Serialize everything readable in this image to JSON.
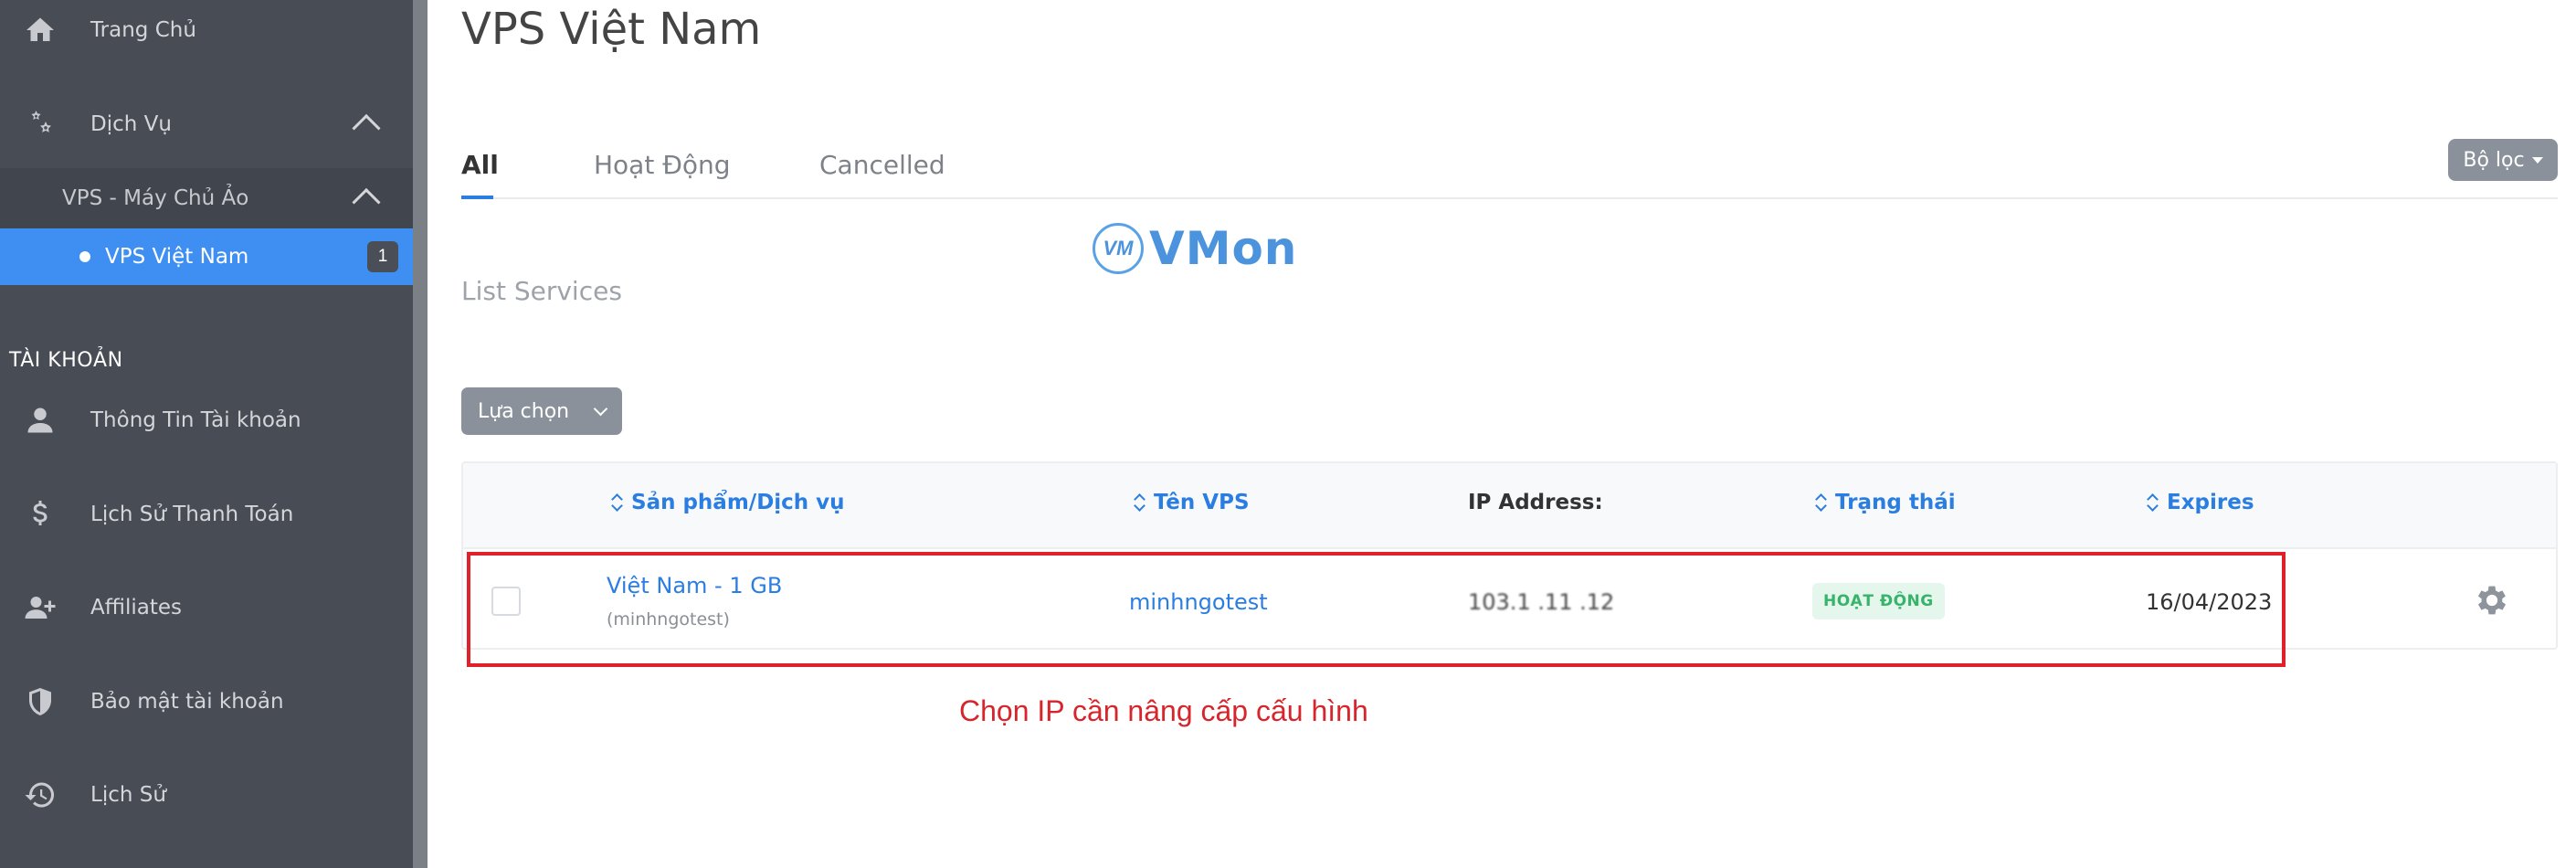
{
  "sidebar": {
    "items": [
      {
        "label": "Trang Chủ",
        "icon": "home-icon"
      },
      {
        "label": "Dịch Vụ",
        "icon": "gears-icon"
      }
    ],
    "sub_group": {
      "label": "VPS - Máy Chủ Ảo"
    },
    "active_item": {
      "label": "VPS Việt Nam",
      "count": "1"
    },
    "account_section": {
      "heading": "TÀI KHOẢN",
      "items": [
        {
          "label": "Thông Tin Tài khoản",
          "icon": "user-icon"
        },
        {
          "label": "Lịch Sử Thanh Toán",
          "icon": "dollar-icon"
        },
        {
          "label": "Affiliates",
          "icon": "user-plus-icon"
        },
        {
          "label": "Bảo mật tài khoản",
          "icon": "shield-icon"
        },
        {
          "label": "Lịch Sử",
          "icon": "history-icon"
        }
      ]
    }
  },
  "main": {
    "title": "VPS Việt Nam",
    "tabs": [
      {
        "label": "All",
        "active": true
      },
      {
        "label": "Hoạt Động",
        "active": false
      },
      {
        "label": "Cancelled",
        "active": false
      }
    ],
    "filter_button": "Bộ lọc",
    "logo": {
      "badge": "VM",
      "text": "VMon"
    },
    "list_title": "List Services",
    "select_button": "Lựa chọn",
    "table": {
      "headers": [
        "Sản phẩm/Dịch vụ",
        "Tên VPS",
        "IP Address:",
        "Trạng thái",
        "Expires"
      ],
      "rows": [
        {
          "product": "Việt Nam - 1 GB",
          "product_sub": "(minhngotest)",
          "vps_name": "minhngotest",
          "ip": "103.1 .11 .12",
          "status": "HOẠT ĐỘNG",
          "expires": "16/04/2023"
        }
      ]
    },
    "annotation": "Chọn IP cần nâng cấp cấu hình"
  },
  "colors": {
    "sidebar_bg": "#484c54",
    "active_blue": "#3f8ff2",
    "link_blue": "#2a7de1",
    "status_green": "#36b56a",
    "highlight_red": "#e0202a"
  }
}
